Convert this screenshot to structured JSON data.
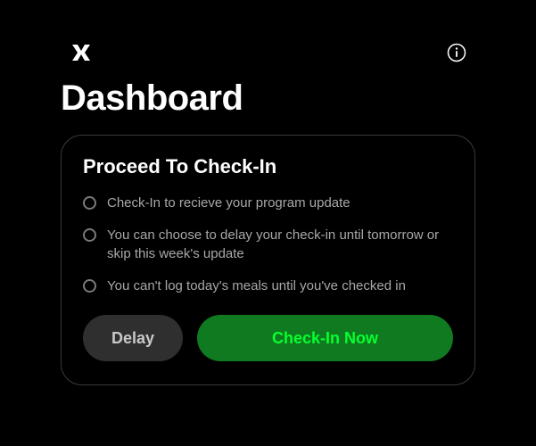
{
  "page_title": "Dashboard",
  "card": {
    "title": "Proceed To Check-In",
    "bullets": [
      "Check-In to recieve your program update",
      "You can choose to delay your check-in until tomorrow or skip this week's update",
      "You can't log today's meals until you've checked in"
    ],
    "delay_label": "Delay",
    "checkin_label": "Check-In Now"
  },
  "icons": {
    "logo": "app-logo",
    "info": "info-icon"
  }
}
